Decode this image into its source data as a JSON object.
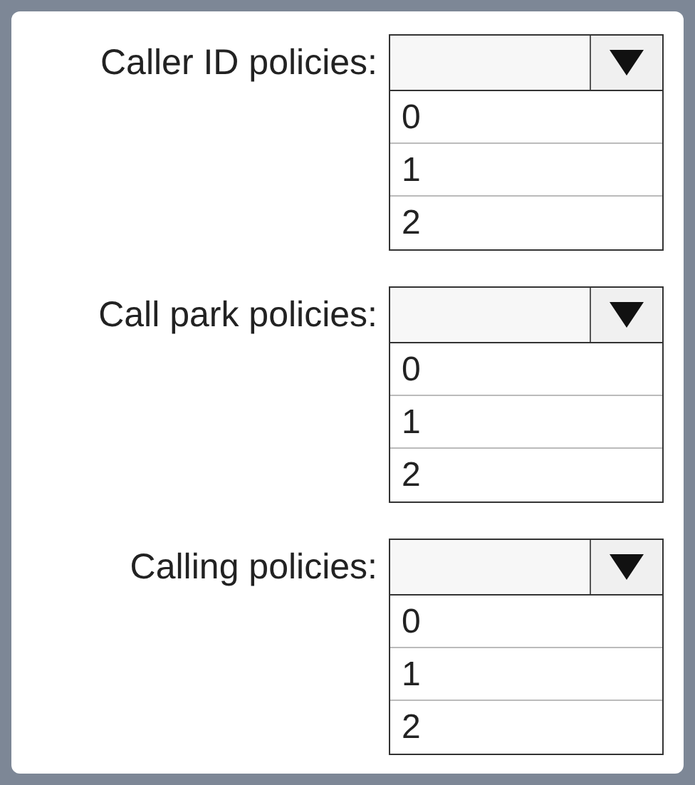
{
  "dropdowns": [
    {
      "label": "Caller ID policies:",
      "options": [
        "0",
        "1",
        "2"
      ]
    },
    {
      "label": "Call park policies:",
      "options": [
        "0",
        "1",
        "2"
      ]
    },
    {
      "label": "Calling policies:",
      "options": [
        "0",
        "1",
        "2"
      ]
    }
  ]
}
